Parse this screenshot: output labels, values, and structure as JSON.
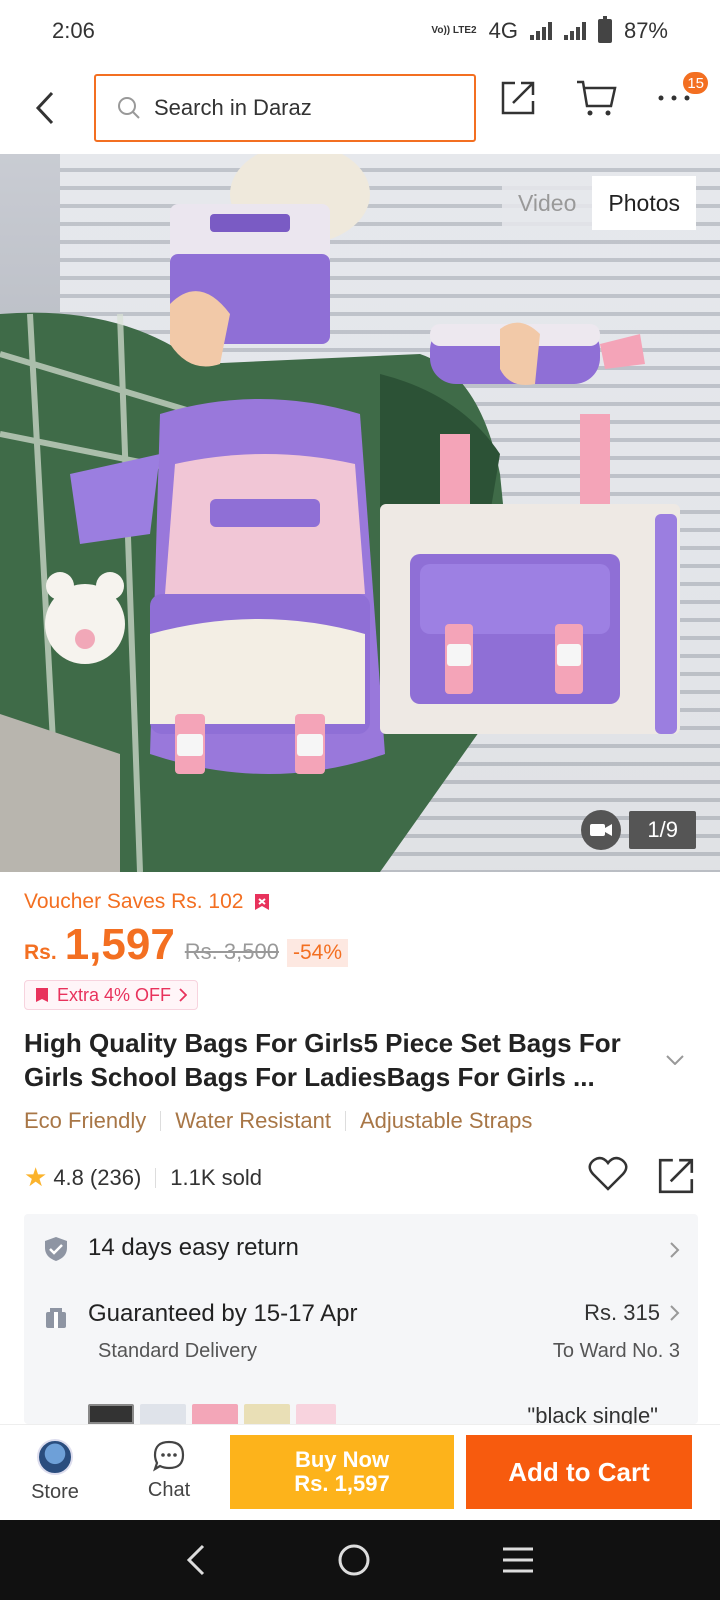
{
  "status": {
    "time": "2:06",
    "network": "4G",
    "volte": "Vo)) LTE2",
    "battery": "87%"
  },
  "header": {
    "search_placeholder": "Search in Daraz",
    "cart_badge": "15"
  },
  "gallery": {
    "video_label": "Video",
    "photos_label": "Photos",
    "counter": "1/9"
  },
  "product": {
    "voucher_text": "Voucher Saves Rs. 102",
    "currency": "Rs.",
    "price": "1,597",
    "old_price": "Rs. 3,500",
    "discount": "-54%",
    "extra_offer": "Extra 4% OFF",
    "title": "High Quality Bags For Girls5 Piece Set Bags For Girls School Bags For LadiesBags For Girls ...",
    "tags": [
      "Eco Friendly",
      "Water Resistant",
      "Adjustable Straps"
    ],
    "rating": "4.8",
    "reviews": "(236)",
    "sold": "1.1K sold"
  },
  "services": {
    "return_text": "14 days easy return",
    "delivery_text": "Guaranteed by 15-17 Apr",
    "delivery_sub": "Standard Delivery",
    "delivery_fee": "Rs. 315",
    "delivery_to": "To Ward No. 3",
    "variant_text": "\"black single\""
  },
  "bottom_bar": {
    "store_label": "Store",
    "chat_label": "Chat",
    "buy_now_line1": "Buy Now",
    "buy_now_line2": "Rs. 1,597",
    "add_to_cart": "Add to Cart"
  },
  "colors": {
    "accent": "#f36f21",
    "buy_now": "#fdb31b",
    "add_to_cart": "#f75b0e",
    "tag": "#a87646"
  }
}
